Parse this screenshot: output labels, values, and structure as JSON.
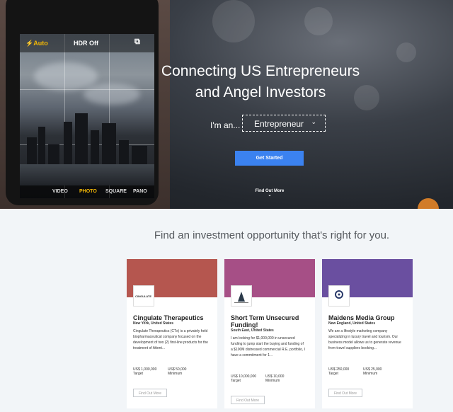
{
  "hero": {
    "title": "Connecting US Entrepreneurs and Angel Investors",
    "im_label": "I'm an...",
    "role_selected": "Entrepreneur",
    "cta_label": "Get Started",
    "find_more_label": "Find Out More",
    "camera": {
      "flash": "⚡Auto",
      "hdr": "HDR Off",
      "modes": [
        "VIDEO",
        "PHOTO",
        "SQUARE",
        "PANO"
      ]
    }
  },
  "section": {
    "title": "Find an investment opportunity that's right for you."
  },
  "cards": [
    {
      "banner_color": "#b5564f",
      "logo_text": "CINGULATE",
      "name": "Cingulate Therapeutics",
      "location": "New York, United States",
      "description": "Cingulate Therapeutics (CTx) is a privately held biopharmaceutical company focused on the development of two (2) first-line products for the treatment of Attent...",
      "target_value": "US$ 1,000,000",
      "target_label": "Target",
      "min_value": "US$ 50,000",
      "min_label": "Minimum",
      "find_label": "Find Out More"
    },
    {
      "banner_color": "#a64f86",
      "logo_text": "",
      "name": "Short Term Unsecured Funding!",
      "location": "South East, United States",
      "description": "I am looking for $1,000,000 in unsecured funding to jump start the buying and funding of a $100M distressed commercial R.E. portfolio, I have a commitment for 1...",
      "target_value": "US$ 10,000,000",
      "target_label": "Target",
      "min_value": "US$ 10,000",
      "min_label": "Minimum",
      "find_label": "Find Out More"
    },
    {
      "banner_color": "#6a4fa0",
      "logo_text": "",
      "name": "Maidens Media Group",
      "location": "New England, United States",
      "description": "We are a lifestyle marketing company specializing in luxury travel and tourism. Our business model allows us to generate revenue from travel suppliers booking...",
      "target_value": "US$ 250,000",
      "target_label": "Target",
      "min_value": "US$ 25,000",
      "min_label": "Minimum",
      "find_label": "Find Out More"
    }
  ]
}
